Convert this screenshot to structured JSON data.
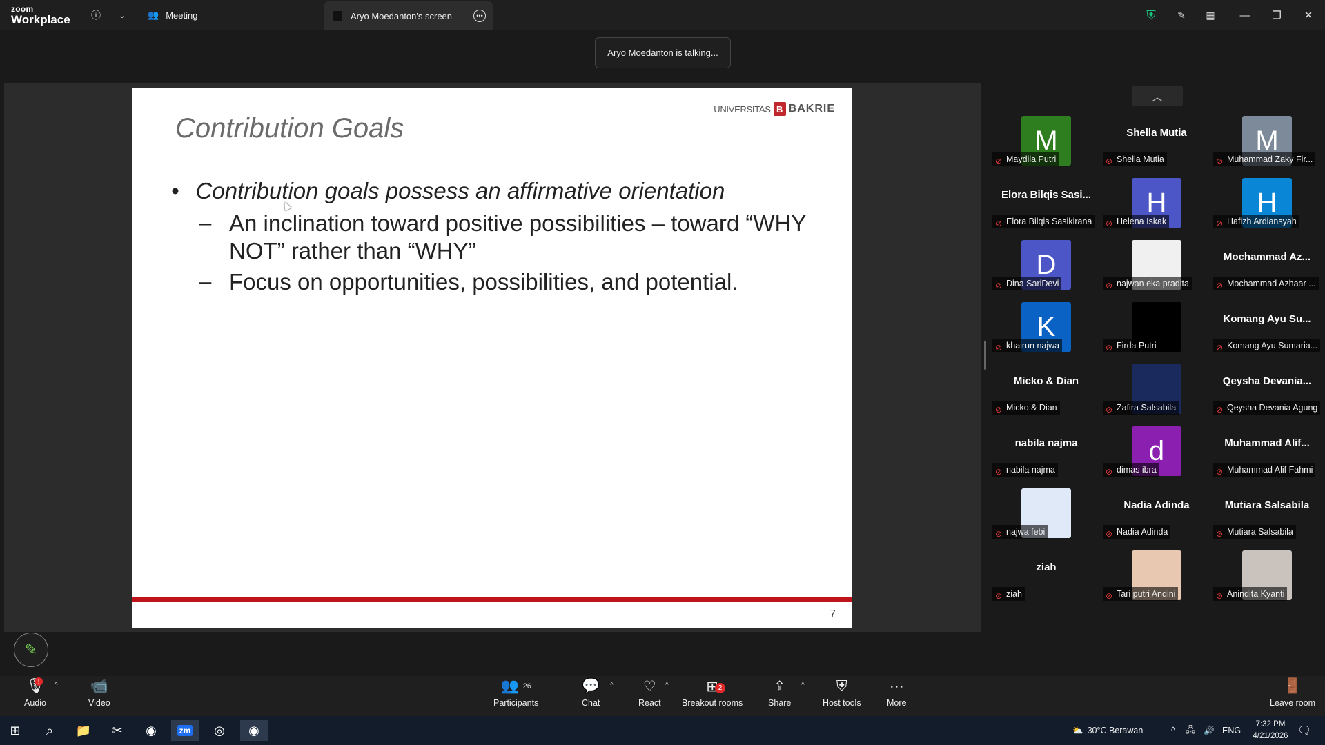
{
  "app": {
    "logo_line1": "zoom",
    "logo_line2": "Workplace"
  },
  "titlebar": {
    "meeting_tab": "Meeting",
    "screen_tab": "Aryo Moedanton's screen"
  },
  "banner": {
    "talking": "Aryo Moedanton is talking..."
  },
  "slide": {
    "title": "Contribution Goals",
    "brand_left": "UNIVERSITAS",
    "brand_mark": "B",
    "brand_right": "BAKRIE",
    "bullet": "•",
    "main_point": "Contribution goals possess an affirmative orientation",
    "dash": "–",
    "sub1": "An inclination toward positive possibilities – toward “WHY NOT” rather than “WHY”",
    "sub2": "Focus on opportunities, possibilities, and  potential.",
    "page": "7"
  },
  "gallery": [
    {
      "big": "",
      "initial": "M",
      "label": "Maydila Putri",
      "bg": "#2e7d1f"
    },
    {
      "big": "Shella Mutia",
      "initial": "",
      "label": "Shella Mutia",
      "bg": ""
    },
    {
      "big": "",
      "initial": "M",
      "label": "Muhammad Zaky Fir...",
      "bg": "#7d8a99"
    },
    {
      "big": "Elora Bilqis Sasi...",
      "initial": "",
      "label": "Elora Bilqis Sasikirana",
      "bg": ""
    },
    {
      "big": "",
      "initial": "H",
      "label": "Helena Iskak",
      "bg": "#4c56c7"
    },
    {
      "big": "",
      "initial": "H",
      "label": "Hafizh Ardiansyah",
      "bg": "#0a86d6"
    },
    {
      "big": "",
      "initial": "D",
      "label": "Dina SariDevi",
      "bg": "#4c56c7"
    },
    {
      "big": "",
      "initial": "",
      "label": "najwan eka pradita",
      "bg": "#f0f0f0"
    },
    {
      "big": "Mochammad Az...",
      "initial": "",
      "label": "Mochammad Azhaar ...",
      "bg": ""
    },
    {
      "big": "",
      "initial": "K",
      "label": "khairun najwa",
      "bg": "#0a63c4"
    },
    {
      "big": "",
      "initial": "",
      "label": "Firda Putri",
      "bg": "#000000"
    },
    {
      "big": "Komang Ayu Su...",
      "initial": "",
      "label": "Komang Ayu Sumaria...",
      "bg": ""
    },
    {
      "big": "Micko & Dian",
      "initial": "",
      "label": "Micko & Dian",
      "bg": ""
    },
    {
      "big": "",
      "initial": "",
      "label": "Zafira Salsabila",
      "bg": "#1b2a5c"
    },
    {
      "big": "Qeysha Devania...",
      "initial": "",
      "label": "Qeysha Devania Agung",
      "bg": ""
    },
    {
      "big": "nabila najma",
      "initial": "",
      "label": "nabila najma",
      "bg": ""
    },
    {
      "big": "",
      "initial": "d",
      "label": "dimas ibra",
      "bg": "#8a1fb0"
    },
    {
      "big": "Muhammad Alif...",
      "initial": "",
      "label": "Muhammad Alif Fahmi",
      "bg": ""
    },
    {
      "big": "",
      "initial": "",
      "label": "najwa febi",
      "bg": "#dfe9f7"
    },
    {
      "big": "Nadia Adinda",
      "initial": "",
      "label": "Nadia Adinda",
      "bg": ""
    },
    {
      "big": "Mutiara Salsabila",
      "initial": "",
      "label": "Mutiara Salsabila",
      "bg": ""
    },
    {
      "big": "ziah",
      "initial": "",
      "label": "ziah",
      "bg": ""
    },
    {
      "big": "",
      "initial": "",
      "label": "Tari putri Andini",
      "bg": "#e8c8b0"
    },
    {
      "big": "",
      "initial": "",
      "label": "Anindita Kyanti",
      "bg": "#c9c2bd"
    }
  ],
  "toolbar": {
    "audio": "Audio",
    "video": "Video",
    "participants": "Participants",
    "participants_count": "26",
    "chat": "Chat",
    "react": "React",
    "breakout": "Breakout rooms",
    "breakout_badge": "2",
    "share": "Share",
    "host_tools": "Host tools",
    "more": "More",
    "leave": "Leave room"
  },
  "taskbar": {
    "weather": "30°C  Berawan",
    "lang": "ENG",
    "time": "7:32 PM",
    "date": "4/21/2026"
  },
  "colors": {
    "accent_red": "#c0141b",
    "toolbar_bg": "#1f1f1f",
    "shield_green": "#19c37d"
  }
}
